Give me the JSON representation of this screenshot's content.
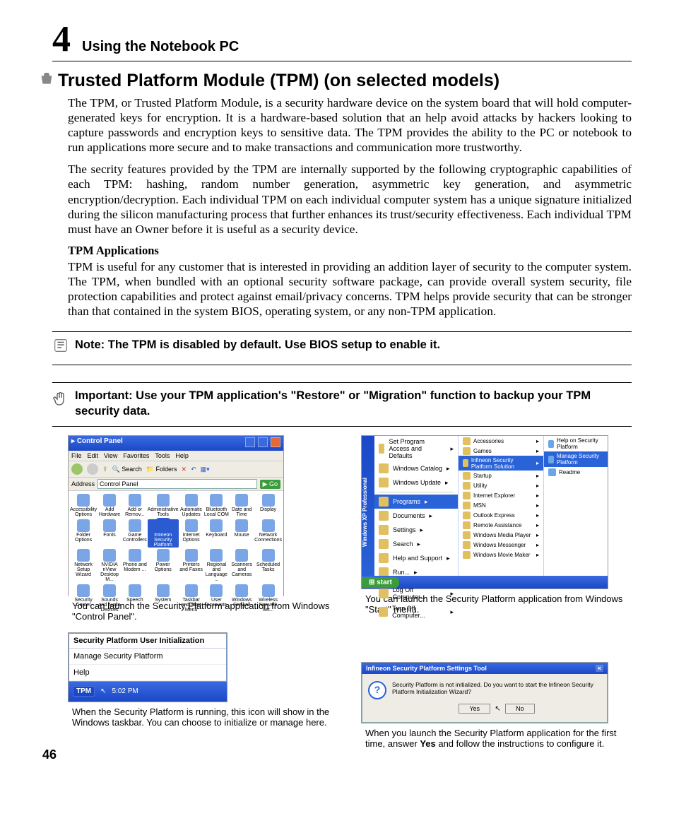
{
  "chapter": {
    "number": "4",
    "title": "Using the Notebook PC"
  },
  "section": {
    "title": "Trusted Platform Module (TPM) (on selected models)"
  },
  "para1": "The TPM, or Trusted Platform Module, is a security hardware device on the system board that will hold computer-generated keys for encryption. It is a hardware-based solution that an help avoid attacks by hackers looking to capture passwords and encryption keys to sensitive data. The TPM provides the ability to the PC or notebook to run applications more secure and to make transactions and communication more trustworthy.",
  "para2": "The secrity features provided by the TPM are internally supported by the following cryptographic capabilities of each TPM: hashing, random number generation, asymmetric key generation, and asymmetric encryption/decryption. Each individual TPM on each individual computer system has a unique signature initialized during the silicon manufacturing process that further enhances its trust/security effectiveness. Each individual TPM must have an Owner before it is useful as a security device.",
  "sub1": "TPM Applications",
  "para3": "TPM is useful for any customer that is interested in providing an addition layer of security to the computer system. The TPM, when bundled with an optional security software package, can provide overall system security, file protection capabilities and protect against email/privacy concerns. TPM helps provide security that can be stronger than that contained in the system BIOS, operating system, or any non-TPM application.",
  "callouts": {
    "note": "Note: The TPM is disabled by default. Use BIOS setup to enable it.",
    "important": "Important: Use your TPM application's \"Restore\" or \"Migration\" function to backup your TPM security data."
  },
  "figA": {
    "title": "Control Panel",
    "menus": [
      "File",
      "Edit",
      "View",
      "Favorites",
      "Tools",
      "Help"
    ],
    "search": "Search",
    "folders": "Folders",
    "address_label": "Address",
    "address_value": "Control Panel",
    "go": "Go",
    "items": [
      "Accessibility Options",
      "Add Hardware",
      "Add or Remov...",
      "Administrative Tools",
      "Automatic Updates",
      "Bluetooth Local COM",
      "Date and Time",
      "Display",
      "Folder Options",
      "Fonts",
      "Game Controllers",
      "Infineon Security Platform",
      "Internet Options",
      "Keyboard",
      "Mouse",
      "Network Connections",
      "Network Setup Wizard",
      "NVIDIA nView Desktop M...",
      "Phone and Modem ...",
      "Power Options",
      "Printers and Faxes",
      "Regional and Language ...",
      "Scanners and Cameras",
      "Scheduled Tasks",
      "Security Center",
      "Sounds and Audio Devices",
      "Speech",
      "System",
      "Taskbar and Start Menu",
      "User Accounts",
      "Windows Firewall",
      "Wireless Network Set..."
    ],
    "caption": "You can launch the Security Platform application from Windows \"Control Panel\"."
  },
  "figB": {
    "strip": "Windows XP Professional",
    "col1": [
      "Set Program Access and Defaults",
      "Windows Catalog",
      "Windows Update",
      "Programs",
      "Documents",
      "Settings",
      "Search",
      "Help and Support",
      "Run...",
      "Log Off Computer...",
      "Turn Off Computer..."
    ],
    "col1_hl_index": 3,
    "col2": [
      "Accessories",
      "Games",
      "Infineon Security Platform Solution",
      "Startup",
      "Utility",
      "Internet Explorer",
      "MSN",
      "Outlook Express",
      "Remote Assistance",
      "Windows Media Player",
      "Windows Messenger",
      "Windows Movie Maker"
    ],
    "col2_hl_index": 2,
    "col3": [
      "Help on Security Platform",
      "Manage Security Platform",
      "Readme"
    ],
    "col3_hl_index": 1,
    "start": "start",
    "caption": "You can launch the Security Platform application from Windows \"Start\" menu."
  },
  "figC": {
    "popup_title": "Security Platform User Initialization",
    "popup_items": [
      "Manage Security Platform",
      "Help"
    ],
    "tpm": "TPM",
    "time": "5:02 PM",
    "caption": "When the Security Platform is running, this icon will show in the Windows taskbar. You can choose to initialize or manage here."
  },
  "figD": {
    "dlg_title": "Infineon Security Platform Settings Tool",
    "dlg_msg": "Security Platform is not initialized. Do you want to start the Infineon Security Platform Initialization Wizard?",
    "yes": "Yes",
    "no": "No",
    "caption_a": "When you launch the Security Platform application for the first time, answer ",
    "caption_yes": "Yes",
    "caption_b": " and follow the instructions to configure it."
  },
  "page_number": "46"
}
